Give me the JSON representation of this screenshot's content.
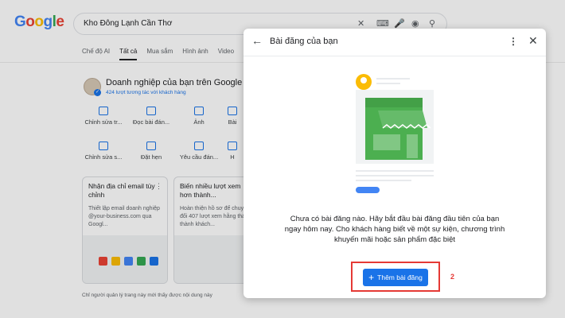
{
  "search": {
    "query": "Kho Đông Lạnh Cần Thơ"
  },
  "logo": {
    "text": "Google"
  },
  "tabs": [
    "Chế độ AI",
    "Tất cả",
    "Mua sắm",
    "Hình ảnh",
    "Video"
  ],
  "business": {
    "title": "Doanh nghiệp của bạn trên Google",
    "subtitle": "424 lượt tương tác với khách hàng"
  },
  "actions_row1": [
    "Chỉnh sửa tr...",
    "Đọc bài đán...",
    "Ảnh",
    "Bài"
  ],
  "actions_row2": [
    "Chỉnh sửa s...",
    "Đặt hẹn",
    "Yêu cầu đán...",
    "H"
  ],
  "cards": [
    {
      "title": "Nhận địa chỉ email tùy chỉnh",
      "body": "Thiết lập email doanh nghiệp @your-business.com qua Googl..."
    },
    {
      "title": "Biến nhiều lượt xem hơn thành...",
      "body": "Hoàn thiện hồ sơ để chuyển đổi 407 lượt xem hằng tháng thành khách..."
    }
  ],
  "footer_note": "Chỉ người quản lý trang này mới thấy được nội dung này",
  "dialog": {
    "title": "Bài đăng của bạn",
    "message": "Chưa có bài đăng nào. Hãy bắt đầu bài đăng đầu tiên của bạn ngay hôm nay. Cho khách hàng biết về một sự kiện, chương trình khuyến mãi hoặc sản phẩm đặc biệt",
    "button_label": "Thêm bài đăng"
  },
  "annotation": {
    "step": "2"
  },
  "colors": {
    "accent": "#1a73e8",
    "storefront": "#4caf50",
    "highlight": "#e53935"
  }
}
